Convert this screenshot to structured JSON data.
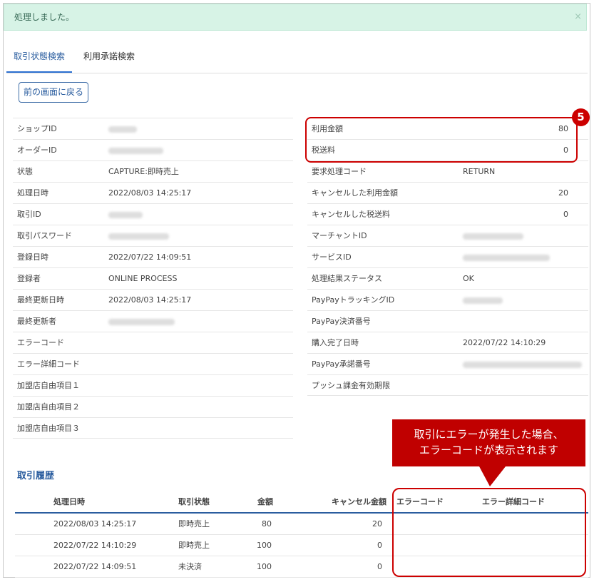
{
  "alert": {
    "message": "処理しました。",
    "close": "×"
  },
  "tabs": [
    {
      "label": "取引状態検索",
      "active": true
    },
    {
      "label": "利用承諾検索",
      "active": false
    }
  ],
  "back_button": "前の画面に戻る",
  "left_fields": [
    {
      "label": "ショップID",
      "value": "",
      "redacted": true
    },
    {
      "label": "オーダーID",
      "value": "",
      "redacted": true
    },
    {
      "label": "状態",
      "value": "CAPTURE:即時売上"
    },
    {
      "label": "処理日時",
      "value": "2022/08/03 14:25:17"
    },
    {
      "label": "取引ID",
      "value": "",
      "redacted": true
    },
    {
      "label": "取引パスワード",
      "value": "",
      "redacted": true
    },
    {
      "label": "登録日時",
      "value": "2022/07/22 14:09:51"
    },
    {
      "label": "登録者",
      "value": "ONLINE PROCESS"
    },
    {
      "label": "最終更新日時",
      "value": "2022/08/03 14:25:17"
    },
    {
      "label": "最終更新者",
      "value": "",
      "redacted": true
    },
    {
      "label": "エラーコード",
      "value": ""
    },
    {
      "label": "エラー詳細コード",
      "value": ""
    },
    {
      "label": "加盟店自由項目１",
      "value": ""
    },
    {
      "label": "加盟店自由項目２",
      "value": ""
    },
    {
      "label": "加盟店自由項目３",
      "value": ""
    }
  ],
  "right_fields": [
    {
      "label": "利用金額",
      "value": "80",
      "numeric": true
    },
    {
      "label": "税送料",
      "value": "0",
      "numeric": true
    },
    {
      "label": "要求処理コード",
      "value": "RETURN"
    },
    {
      "label": "キャンセルした利用金額",
      "value": "20",
      "numeric": true
    },
    {
      "label": "キャンセルした税送料",
      "value": "0",
      "numeric": true
    },
    {
      "label": "マーチャントID",
      "value": "",
      "redacted": true
    },
    {
      "label": "サービスID",
      "value": "",
      "redacted": true
    },
    {
      "label": "処理結果ステータス",
      "value": "OK"
    },
    {
      "label": "PayPayトラッキングID",
      "value": "",
      "redacted": true
    },
    {
      "label": "PayPay決済番号",
      "value": ""
    },
    {
      "label": "購入完了日時",
      "value": "2022/07/22 14:10:29"
    },
    {
      "label": "PayPay承諾番号",
      "value": "",
      "redacted": true
    },
    {
      "label": "プッシュ課金有効期限",
      "value": ""
    }
  ],
  "annotation": {
    "badge": "5",
    "callout_line1": "取引にエラーが発生した場合、",
    "callout_line2": "エラーコードが表示されます",
    "accent_color": "#cc0000"
  },
  "history": {
    "title": "取引履歴",
    "headers": [
      "処理日時",
      "取引状態",
      "金額",
      "キャンセル金額",
      "エラーコード",
      "エラー詳細コード"
    ],
    "rows": [
      [
        "2022/08/03 14:25:17",
        "即時売上",
        "80",
        "20",
        "",
        ""
      ],
      [
        "2022/07/22 14:10:29",
        "即時売上",
        "100",
        "0",
        "",
        ""
      ],
      [
        "2022/07/22 14:09:51",
        "未決済",
        "100",
        "0",
        "",
        ""
      ]
    ]
  }
}
